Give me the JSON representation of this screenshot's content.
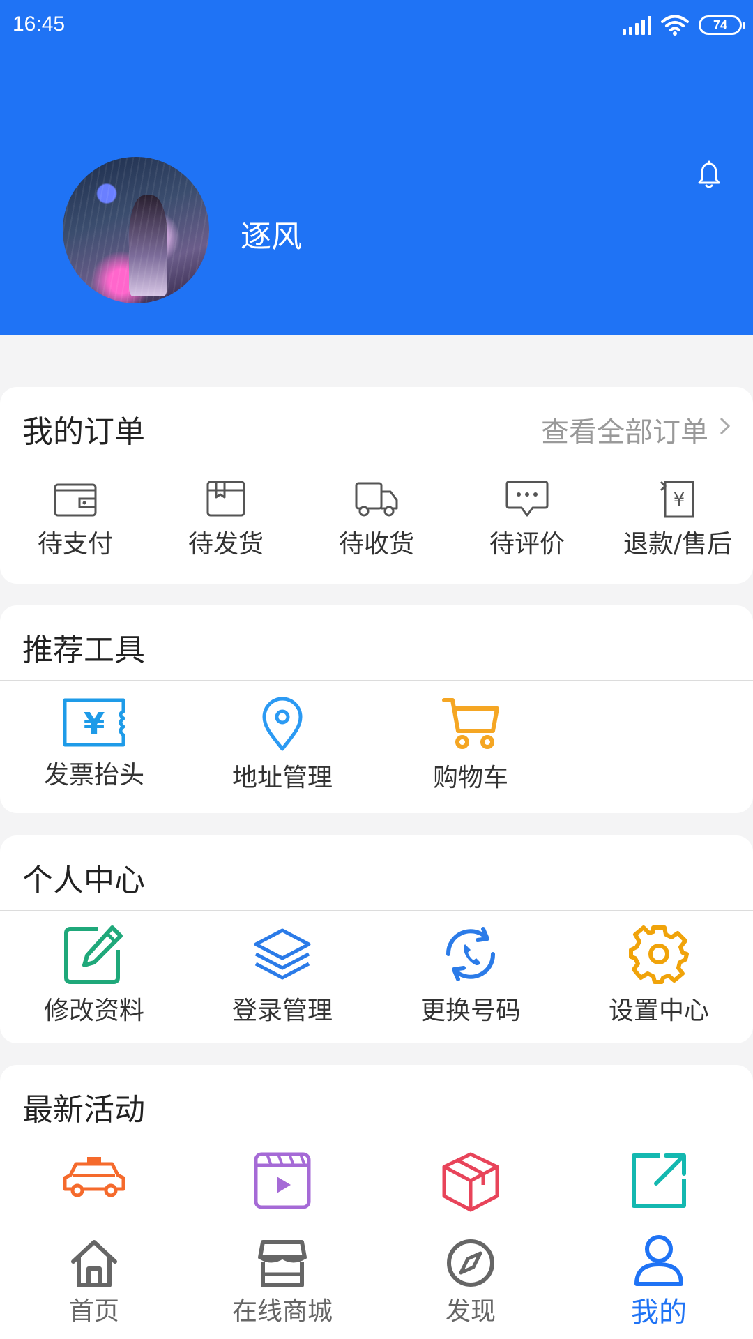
{
  "status_bar": {
    "time": "16:45",
    "battery": "74"
  },
  "profile": {
    "username": "逐风"
  },
  "orders": {
    "title": "我的订单",
    "view_all": "查看全部订单",
    "items": [
      {
        "label": "待支付",
        "icon": "wallet-icon"
      },
      {
        "label": "待发货",
        "icon": "package-icon"
      },
      {
        "label": "待收货",
        "icon": "truck-icon"
      },
      {
        "label": "待评价",
        "icon": "comment-icon"
      },
      {
        "label": "退款/售后",
        "icon": "refund-icon"
      }
    ]
  },
  "tools": {
    "title": "推荐工具",
    "items": [
      {
        "label": "发票抬头",
        "icon": "invoice-icon",
        "color": "#1e9be8"
      },
      {
        "label": "地址管理",
        "icon": "location-pin-icon",
        "color": "#2b9af3"
      },
      {
        "label": "购物车",
        "icon": "cart-icon",
        "color": "#f5a623"
      }
    ]
  },
  "personal": {
    "title": "个人中心",
    "items": [
      {
        "label": "修改资料",
        "icon": "edit-icon",
        "color": "#1fa87a"
      },
      {
        "label": "登录管理",
        "icon": "layers-icon",
        "color": "#2b7be8"
      },
      {
        "label": "更换号码",
        "icon": "phone-refresh-icon",
        "color": "#2b7be8"
      },
      {
        "label": "设置中心",
        "icon": "gear-icon",
        "color": "#f0a30a"
      }
    ]
  },
  "activities": {
    "title": "最新活动",
    "items": [
      {
        "icon": "taxi-icon",
        "color": "#f56a2c"
      },
      {
        "icon": "video-icon",
        "color": "#a56ad6"
      },
      {
        "icon": "box-icon",
        "color": "#e8445a"
      },
      {
        "icon": "share-icon",
        "color": "#14b8b0"
      }
    ]
  },
  "tabbar": {
    "items": [
      {
        "label": "首页",
        "icon": "home-icon"
      },
      {
        "label": "在线商城",
        "icon": "store-icon"
      },
      {
        "label": "发现",
        "icon": "compass-icon"
      },
      {
        "label": "我的",
        "icon": "user-icon"
      }
    ],
    "active_color": "#1f73f5",
    "inactive_color": "#666666"
  },
  "colors": {
    "header": "#1f73f5"
  }
}
